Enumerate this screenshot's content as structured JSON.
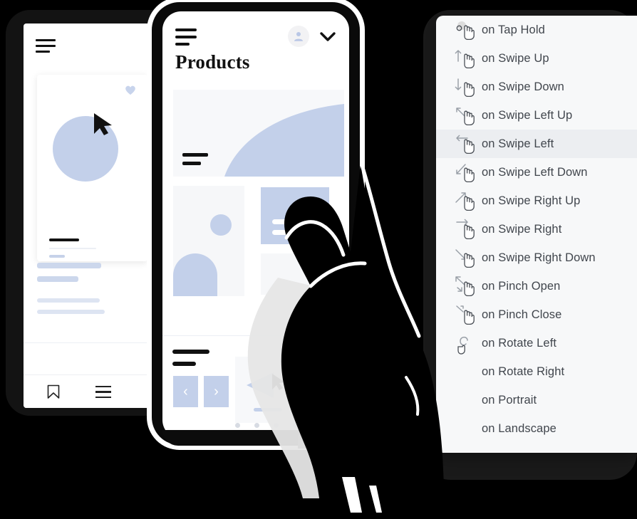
{
  "background_color": "#000000",
  "accent_color": "#c3d0ea",
  "panel_bg": "#f7f8f9",
  "selected_row_bg": "#eceef1",
  "text_color": "#41464d",
  "back_device": {
    "name": "background-phone",
    "menu_icon": "hamburger-icon",
    "card": {
      "favorite_icon": "heart-icon",
      "cursor_icon": "cursor-arrow-icon",
      "circle_shape": "circle-placeholder"
    },
    "tabbar": {
      "items": [
        {
          "icon": "bookmark-icon"
        },
        {
          "icon": "list-icon"
        }
      ]
    }
  },
  "front_device": {
    "name": "foreground-phone",
    "header": {
      "menu_icon": "hamburger-icon",
      "avatar_icon": "user-avatar-icon",
      "chevron_icon": "chevron-down-icon"
    },
    "page_title": "Products",
    "hero": {
      "shape": "curve-graphic"
    },
    "carousel": {
      "prev_label": "‹",
      "next_label": "›",
      "dots": [
        false,
        false,
        false,
        true
      ]
    },
    "media": {
      "play_icon": "triangle-left-icon",
      "cursor_icon": "cursor-arrow-icon"
    }
  },
  "hand": {
    "name": "hand-silhouette-illustration"
  },
  "gesture_menu": {
    "name": "gesture-trigger-menu",
    "selected": "on Swipe Left",
    "items": [
      {
        "label": "on Tap Hold",
        "icon": "tap-hold-gesture-icon",
        "selected": false
      },
      {
        "label": "on Swipe Up",
        "icon": "swipe-up-gesture-icon",
        "selected": false
      },
      {
        "label": "on Swipe Down",
        "icon": "swipe-down-gesture-icon",
        "selected": false
      },
      {
        "label": "on Swipe Left Up",
        "icon": "swipe-left-up-gesture-icon",
        "selected": false
      },
      {
        "label": "on Swipe Left",
        "icon": "swipe-left-gesture-icon",
        "selected": true
      },
      {
        "label": "on Swipe Left Down",
        "icon": "swipe-left-down-gesture-icon",
        "selected": false
      },
      {
        "label": "on Swipe Right Up",
        "icon": "swipe-right-up-gesture-icon",
        "selected": false
      },
      {
        "label": "on Swipe Right",
        "icon": "swipe-right-gesture-icon",
        "selected": false
      },
      {
        "label": "on Swipe Right Down",
        "icon": "swipe-right-down-gesture-icon",
        "selected": false
      },
      {
        "label": "on Pinch Open",
        "icon": "pinch-open-gesture-icon",
        "selected": false
      },
      {
        "label": "on Pinch Close",
        "icon": "pinch-close-gesture-icon",
        "selected": false
      },
      {
        "label": "on Rotate Left",
        "icon": "rotate-left-gesture-icon",
        "selected": false
      },
      {
        "label": "on Rotate Right",
        "icon": "rotate-right-gesture-icon",
        "selected": false
      },
      {
        "label": "on Portrait",
        "icon": "portrait-orientation-icon",
        "selected": false
      },
      {
        "label": "on Landscape",
        "icon": "landscape-orientation-icon",
        "selected": false
      }
    ]
  }
}
